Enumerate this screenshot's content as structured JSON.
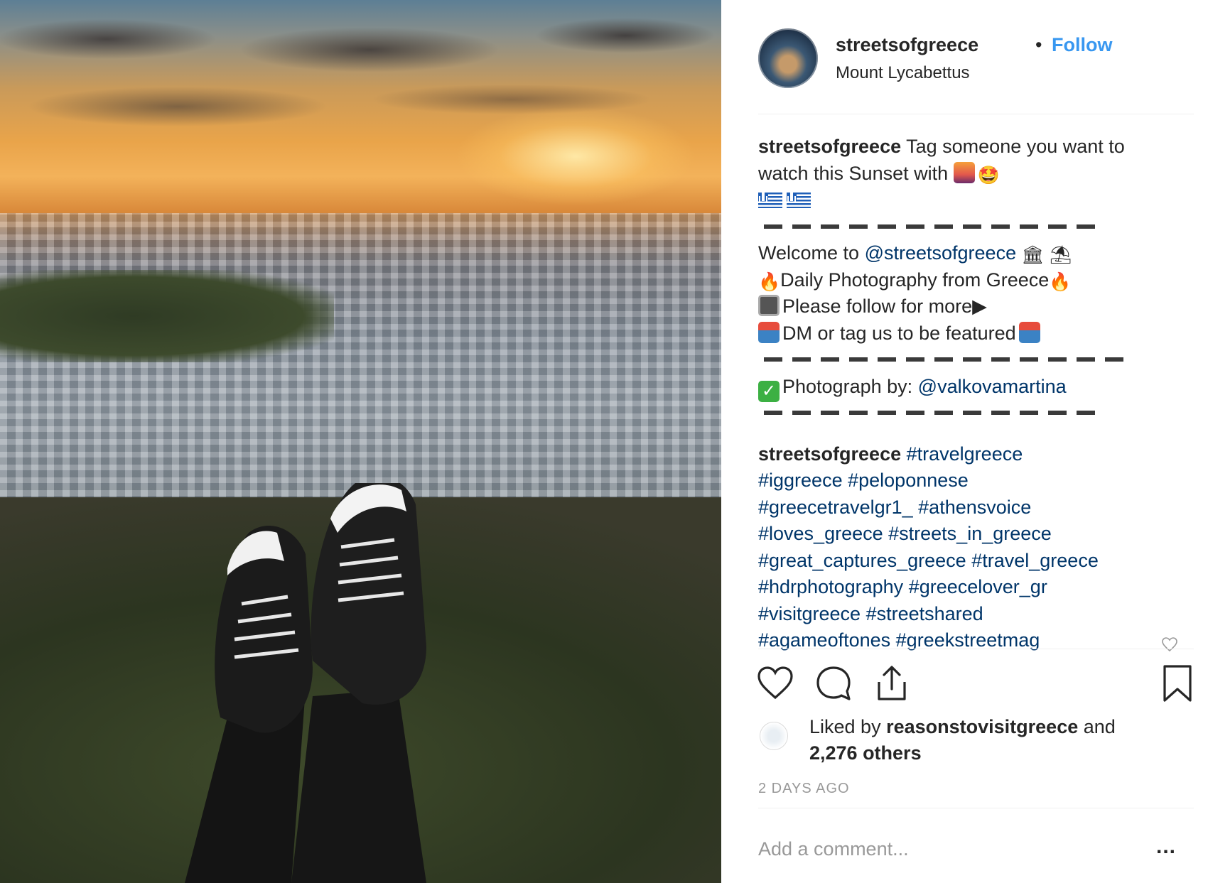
{
  "post": {
    "username": "streetsofgreece",
    "separator": "•",
    "follow_label": "Follow",
    "location": "Mount Lycabettus"
  },
  "caption": {
    "username": "streetsofgreece",
    "line1": "Tag someone you want to",
    "line2": "watch this Sunset with",
    "welcome_prefix": "Welcome to",
    "welcome_mention": "@streetsofgreece",
    "daily": "Daily Photography from Greece",
    "follow_more": "Please follow for more",
    "follow_arrow": "▶",
    "dm": "DM or tag us to be featured",
    "photo_by_prefix": "Photograph by:",
    "photo_by_mention": "@valkovamartina"
  },
  "comment": {
    "username": "streetsofgreece",
    "hashtags": [
      [
        "#travelgreece"
      ],
      [
        "#iggreece",
        "#peloponnese"
      ],
      [
        "#greecetravelgr1_",
        "#athensvoice"
      ],
      [
        "#loves_greece",
        "#streets_in_greece"
      ],
      [
        "#great_captures_greece",
        "#travel_greece"
      ],
      [
        "#hdrphotography",
        "#greecelover_gr"
      ],
      [
        "#visitgreece",
        "#streetshared"
      ],
      [
        "#agameoftones",
        "#greekstreetmag"
      ]
    ]
  },
  "likes": {
    "prefix": "Liked by",
    "user": "reasonstovisitgreece",
    "suffix": "and",
    "others": "2,276 others"
  },
  "timestamp": "2 DAYS AGO",
  "comment_input": {
    "placeholder": "Add a comment..."
  },
  "more_label": "...",
  "icons": {
    "like": "heart-icon",
    "comment": "comment-icon",
    "share": "share-icon",
    "save": "bookmark-icon"
  },
  "colors": {
    "link": "#003569",
    "follow": "#3897f0",
    "text": "#262626",
    "muted": "#999999"
  }
}
